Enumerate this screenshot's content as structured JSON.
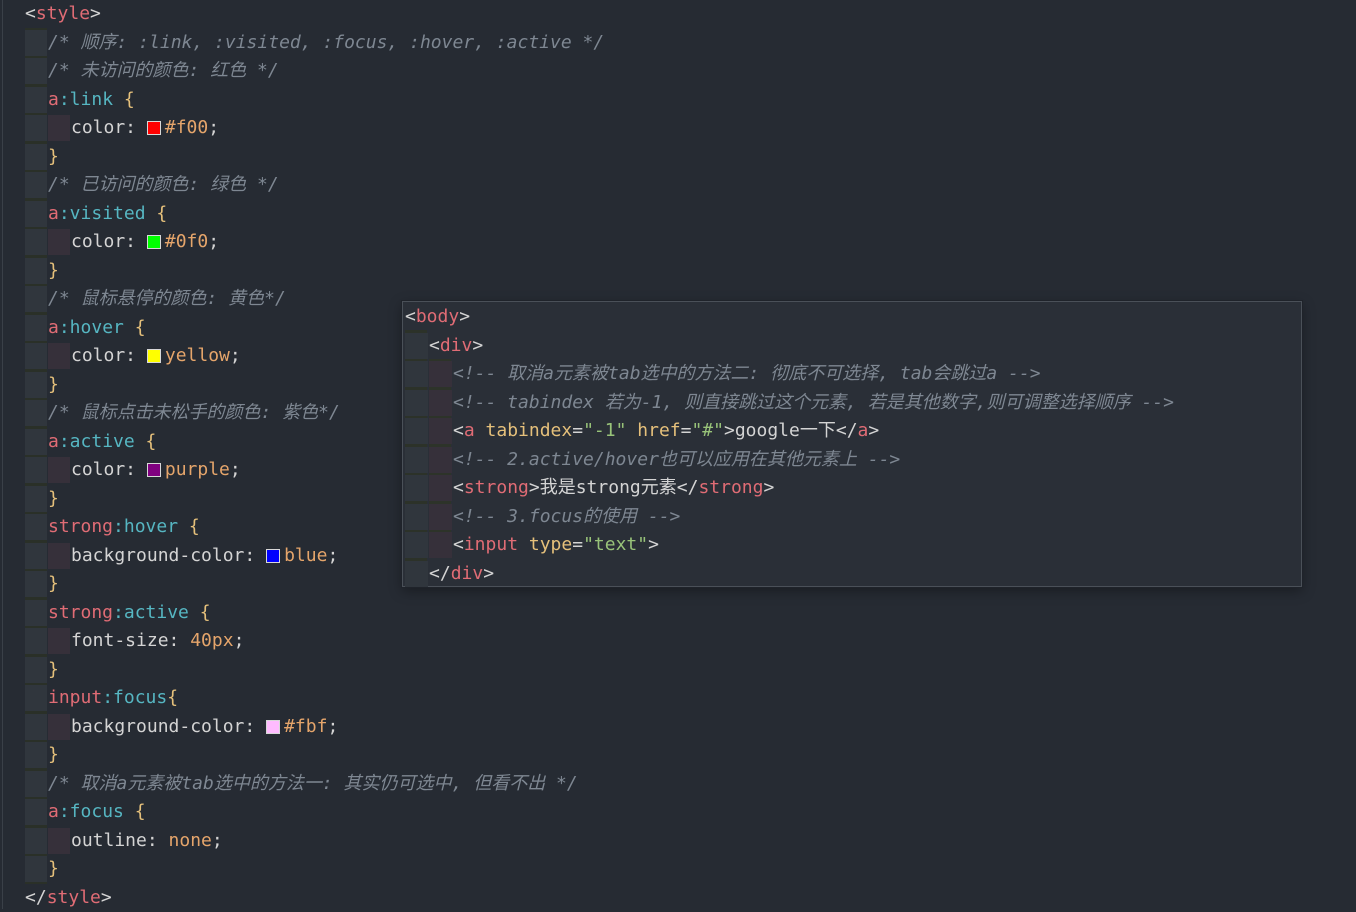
{
  "css": {
    "lines": [
      {
        "indent": 0,
        "tokens": [
          {
            "c": "punct",
            "t": "<"
          },
          {
            "c": "tag",
            "t": "style"
          },
          {
            "c": "punct",
            "t": ">"
          }
        ]
      },
      {
        "indent": 1,
        "tokens": [
          {
            "c": "comment",
            "t": "/* 顺序: :link, :visited, :focus, :hover, :active */"
          }
        ]
      },
      {
        "indent": 1,
        "tokens": [
          {
            "c": "comment",
            "t": "/* 未访问的颜色: 红色 */"
          }
        ]
      },
      {
        "indent": 1,
        "tokens": [
          {
            "c": "sel",
            "t": "a"
          },
          {
            "c": "pseudo",
            "t": ":link"
          },
          {
            "c": "brace",
            "t": " {"
          }
        ]
      },
      {
        "indent": 2,
        "tokens": [
          {
            "c": "prop",
            "t": "color: "
          },
          {
            "c": "swatch",
            "t": "",
            "color": "#ff0000"
          },
          {
            "c": "val",
            "t": "#f00"
          },
          {
            "c": "punct",
            "t": ";"
          }
        ]
      },
      {
        "indent": 1,
        "tokens": [
          {
            "c": "brace",
            "t": "}"
          }
        ]
      },
      {
        "indent": 1,
        "tokens": [
          {
            "c": "comment",
            "t": "/* 已访问的颜色: 绿色 */"
          }
        ]
      },
      {
        "indent": 1,
        "tokens": [
          {
            "c": "sel",
            "t": "a"
          },
          {
            "c": "pseudo",
            "t": ":visited"
          },
          {
            "c": "brace",
            "t": " {"
          }
        ]
      },
      {
        "indent": 2,
        "tokens": [
          {
            "c": "prop",
            "t": "color: "
          },
          {
            "c": "swatch",
            "t": "",
            "color": "#00ff00"
          },
          {
            "c": "val",
            "t": "#0f0"
          },
          {
            "c": "punct",
            "t": ";"
          }
        ]
      },
      {
        "indent": 1,
        "tokens": [
          {
            "c": "brace",
            "t": "}"
          }
        ]
      },
      {
        "indent": 1,
        "tokens": [
          {
            "c": "comment",
            "t": "/* 鼠标悬停的颜色: 黄色*/"
          }
        ]
      },
      {
        "indent": 1,
        "tokens": [
          {
            "c": "sel",
            "t": "a"
          },
          {
            "c": "pseudo",
            "t": ":hover"
          },
          {
            "c": "brace",
            "t": " {"
          }
        ]
      },
      {
        "indent": 2,
        "tokens": [
          {
            "c": "prop",
            "t": "color: "
          },
          {
            "c": "swatch",
            "t": "",
            "color": "#ffff00"
          },
          {
            "c": "val",
            "t": "yellow"
          },
          {
            "c": "punct",
            "t": ";"
          }
        ]
      },
      {
        "indent": 1,
        "tokens": [
          {
            "c": "brace",
            "t": "}"
          }
        ]
      },
      {
        "indent": 1,
        "tokens": [
          {
            "c": "comment",
            "t": "/* 鼠标点击未松手的颜色: 紫色*/"
          }
        ]
      },
      {
        "indent": 1,
        "tokens": [
          {
            "c": "sel",
            "t": "a"
          },
          {
            "c": "pseudo",
            "t": ":active"
          },
          {
            "c": "brace",
            "t": " {"
          }
        ]
      },
      {
        "indent": 2,
        "tokens": [
          {
            "c": "prop",
            "t": "color: "
          },
          {
            "c": "swatch",
            "t": "",
            "color": "#800080"
          },
          {
            "c": "val",
            "t": "purple"
          },
          {
            "c": "punct",
            "t": ";"
          }
        ]
      },
      {
        "indent": 1,
        "tokens": [
          {
            "c": "brace",
            "t": "}"
          }
        ]
      },
      {
        "indent": 1,
        "tokens": [
          {
            "c": "sel",
            "t": "strong"
          },
          {
            "c": "pseudo",
            "t": ":hover"
          },
          {
            "c": "brace",
            "t": " {"
          }
        ]
      },
      {
        "indent": 2,
        "tokens": [
          {
            "c": "prop",
            "t": "background-color: "
          },
          {
            "c": "swatch",
            "t": "",
            "color": "#0000ff"
          },
          {
            "c": "val",
            "t": "blue"
          },
          {
            "c": "punct",
            "t": ";"
          }
        ]
      },
      {
        "indent": 1,
        "tokens": [
          {
            "c": "brace",
            "t": "}"
          }
        ]
      },
      {
        "indent": 1,
        "tokens": [
          {
            "c": "sel",
            "t": "strong"
          },
          {
            "c": "pseudo",
            "t": ":active"
          },
          {
            "c": "brace",
            "t": " {"
          }
        ]
      },
      {
        "indent": 2,
        "tokens": [
          {
            "c": "prop",
            "t": "font-size: "
          },
          {
            "c": "val",
            "t": "40px"
          },
          {
            "c": "punct",
            "t": ";"
          }
        ]
      },
      {
        "indent": 1,
        "tokens": [
          {
            "c": "brace",
            "t": "}"
          }
        ]
      },
      {
        "indent": 1,
        "tokens": [
          {
            "c": "sel",
            "t": "input"
          },
          {
            "c": "pseudo",
            "t": ":focus"
          },
          {
            "c": "brace",
            "t": "{"
          }
        ]
      },
      {
        "indent": 2,
        "tokens": [
          {
            "c": "prop",
            "t": "background-color: "
          },
          {
            "c": "swatch",
            "t": "",
            "color": "#ffbbff"
          },
          {
            "c": "val",
            "t": "#fbf"
          },
          {
            "c": "punct",
            "t": ";"
          }
        ]
      },
      {
        "indent": 1,
        "tokens": [
          {
            "c": "brace",
            "t": "}"
          }
        ]
      },
      {
        "indent": 1,
        "tokens": [
          {
            "c": "comment",
            "t": "/* 取消a元素被tab选中的方法一: 其实仍可选中, 但看不出 */"
          }
        ]
      },
      {
        "indent": 1,
        "tokens": [
          {
            "c": "sel",
            "t": "a"
          },
          {
            "c": "pseudo",
            "t": ":focus"
          },
          {
            "c": "brace",
            "t": " {"
          }
        ]
      },
      {
        "indent": 2,
        "tokens": [
          {
            "c": "prop",
            "t": "outline: "
          },
          {
            "c": "val",
            "t": "none"
          },
          {
            "c": "punct",
            "t": ";"
          }
        ]
      },
      {
        "indent": 1,
        "tokens": [
          {
            "c": "brace",
            "t": "}"
          }
        ]
      },
      {
        "indent": 0,
        "tokens": [
          {
            "c": "punct",
            "t": "</"
          },
          {
            "c": "tag",
            "t": "style"
          },
          {
            "c": "punct",
            "t": ">"
          }
        ]
      }
    ]
  },
  "html_popup": {
    "lines": [
      {
        "indent": 0,
        "tokens": [
          {
            "c": "punct",
            "t": "<"
          },
          {
            "c": "tag",
            "t": "body"
          },
          {
            "c": "punct",
            "t": ">"
          }
        ]
      },
      {
        "indent": 1,
        "tokens": [
          {
            "c": "punct",
            "t": "<"
          },
          {
            "c": "tag",
            "t": "div"
          },
          {
            "c": "punct",
            "t": ">"
          }
        ]
      },
      {
        "indent": 2,
        "tokens": [
          {
            "c": "comment",
            "t": "<!-- 取消a元素被tab选中的方法二: 彻底不可选择, tab会跳过a -->"
          }
        ]
      },
      {
        "indent": 2,
        "tokens": [
          {
            "c": "comment",
            "t": "<!-- tabindex 若为-1, 则直接跳过这个元素, 若是其他数字,则可调整选择顺序 -->"
          }
        ]
      },
      {
        "indent": 2,
        "tokens": [
          {
            "c": "punct",
            "t": "<"
          },
          {
            "c": "tag",
            "t": "a"
          },
          {
            "c": "attr",
            "t": " tabindex"
          },
          {
            "c": "punct",
            "t": "="
          },
          {
            "c": "str",
            "t": "\"-1\""
          },
          {
            "c": "attr",
            "t": " href"
          },
          {
            "c": "punct",
            "t": "="
          },
          {
            "c": "str",
            "t": "\"#\""
          },
          {
            "c": "punct",
            "t": ">"
          },
          {
            "c": "text",
            "t": "google一下"
          },
          {
            "c": "punct",
            "t": "</"
          },
          {
            "c": "tag",
            "t": "a"
          },
          {
            "c": "punct",
            "t": ">"
          }
        ]
      },
      {
        "indent": 2,
        "tokens": [
          {
            "c": "comment",
            "t": "<!-- 2.active/hover也可以应用在其他元素上 -->"
          }
        ]
      },
      {
        "indent": 2,
        "tokens": [
          {
            "c": "punct",
            "t": "<"
          },
          {
            "c": "tag",
            "t": "strong"
          },
          {
            "c": "punct",
            "t": ">"
          },
          {
            "c": "text",
            "t": "我是strong元素"
          },
          {
            "c": "punct",
            "t": "</"
          },
          {
            "c": "tag",
            "t": "strong"
          },
          {
            "c": "punct",
            "t": ">"
          }
        ]
      },
      {
        "indent": 2,
        "tokens": [
          {
            "c": "comment",
            "t": "<!-- 3.focus的使用 -->"
          }
        ]
      },
      {
        "indent": 2,
        "tokens": [
          {
            "c": "punct",
            "t": "<"
          },
          {
            "c": "tag",
            "t": "input"
          },
          {
            "c": "attr",
            "t": " type"
          },
          {
            "c": "punct",
            "t": "="
          },
          {
            "c": "str",
            "t": "\"text\""
          },
          {
            "c": "punct",
            "t": ">"
          }
        ]
      },
      {
        "indent": 1,
        "tokens": [
          {
            "c": "punct",
            "t": "</"
          },
          {
            "c": "tag",
            "t": "div"
          },
          {
            "c": "punct",
            "t": ">"
          }
        ]
      }
    ]
  }
}
